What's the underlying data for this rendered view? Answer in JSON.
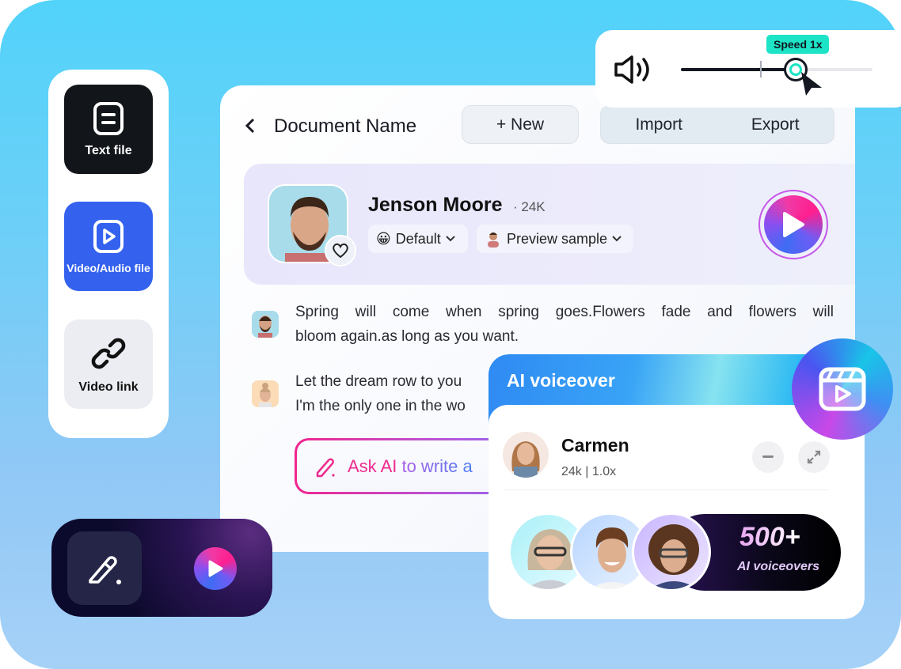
{
  "speed": {
    "badge": "Speed  1x",
    "value_fraction": 0.6,
    "icon": "speaker-icon"
  },
  "sources": [
    {
      "label": "Text file",
      "icon": "text-file-icon"
    },
    {
      "label": "Video/Audio file",
      "icon": "video-file-icon"
    },
    {
      "label": "Video link",
      "icon": "link-icon"
    }
  ],
  "document": {
    "back": "<",
    "title": "Document Name",
    "new_label": "+ New",
    "import_label": "Import",
    "export_label": "Export"
  },
  "voice": {
    "name": "Jenson Moore",
    "count": "· 24K",
    "style": "Default",
    "style_emoji": "😀",
    "preview": "Preview sample"
  },
  "script_lines": [
    {
      "line1": "Spring will come when spring goes.Flowers fade and flowers will",
      "line2": "bloom again.as long as you want."
    },
    {
      "line1": "Let the dream row to you",
      "line2": "I'm the only one in the wo"
    }
  ],
  "ask_ai": {
    "part1": "Ask AI",
    "part2": " to write a"
  },
  "ai_voiceover": {
    "title": "AI voiceover",
    "speaker_name": "Carmen",
    "speaker_meta": "24k | 1.0x",
    "promo_count": "500+",
    "promo_label": "AI voiceovers"
  }
}
